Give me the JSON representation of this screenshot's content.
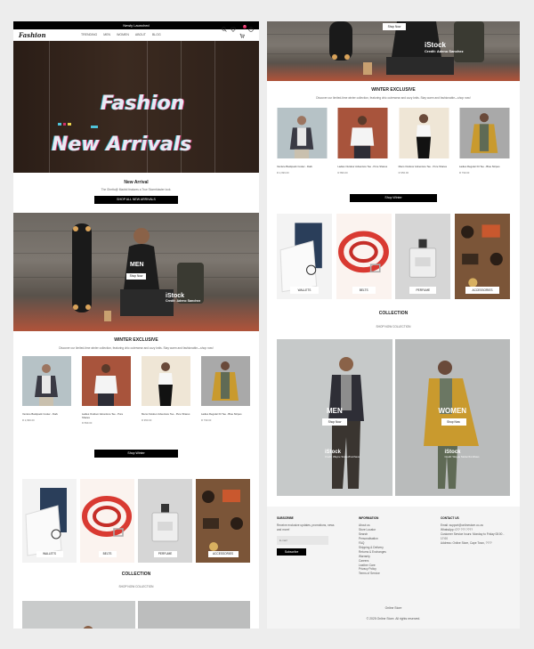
{
  "announcement": "Newly Launched",
  "brand": "Fashion",
  "nav": {
    "links": [
      "TRENDING",
      "MEN",
      "WOMEN",
      "ABOUT",
      "BLOG"
    ],
    "icons": [
      "search-icon",
      "heart-icon",
      "cart-icon",
      "user-icon"
    ],
    "cart_count": "0"
  },
  "hero": {
    "line1": "Fashion",
    "line2": "New Arrivals"
  },
  "new_arrival": {
    "title": "New Arrival",
    "subtitle": "The Ghetto@ Madrid features a True Stormblaster look.",
    "button": "SHOP ALL NEW ARRIVALS"
  },
  "men_banner": {
    "label": "MEN",
    "button": "Shop Now",
    "credit_brand": "iStock",
    "credit_text": "Credit: Adeno Sanchez"
  },
  "winter": {
    "title": "WINTER EXCLUSIVE",
    "subtitle": "Discover our limited-time winter collection, featuring chic outerwear and cozy knits. Stay warm and fashionable—shop now!",
    "button": "Shop Winter",
    "products": [
      {
        "name": "Venture Backpack Cooler - Dark",
        "price": "R 2,999.00"
      },
      {
        "name": "Ladies Outdoor Adventure Tee - Pure Shares",
        "price": "R 899.00"
      },
      {
        "name": "Mens Outdoor Adventure Tee - Pure Shares",
        "price": "R 950.00"
      },
      {
        "name": "Ladies Regular Fit Tee - Blue Stripes",
        "price": "R 799.00"
      }
    ]
  },
  "categories": [
    "WALLETS",
    "BELTS",
    "PERFUME",
    "ACCESSORIES"
  ],
  "collection": {
    "title": "COLLECTION",
    "subtitle": "SHOP NOW COLLECTION",
    "men_label": "MEN",
    "women_label": "WOMEN",
    "button": "Shop Now",
    "credit_brand": "iStock",
    "credit_text": "Credit: Wayne Stuber/Fonthaus"
  },
  "footer": {
    "subscribe_title": "SUBSCRIBE",
    "subscribe_text": "Receive exclusive updates, promotions, news and more!",
    "email_placeholder": "E-mail",
    "subscribe_button": "Subscribe",
    "info_title": "INFORMATION",
    "info_links": [
      "About us",
      "Store Locator",
      "Search",
      "Personalisation",
      "FAQ",
      "Shipping & Delivery",
      "Returns & Exchanges",
      "Warranty",
      "Careers",
      "Leather Care",
      "Privacy Policy",
      "Terms of Service"
    ],
    "contact_title": "CONTACT US",
    "contact_lines": [
      "Email: support@onlinestore.co.za",
      "WhatsApp: 0?? ??? ????",
      "Customer Service hours: Monday to Friday 08:00 - 17:00",
      "Address: Online Store, Cape Town, ????"
    ],
    "store_name": "Online Store",
    "copyright": "© 2025 Online Store. All rights reserved."
  },
  "colors": {
    "accent_black": "#000000",
    "hero_bg": "#2f2119",
    "cart_badge": "#e0245e"
  }
}
